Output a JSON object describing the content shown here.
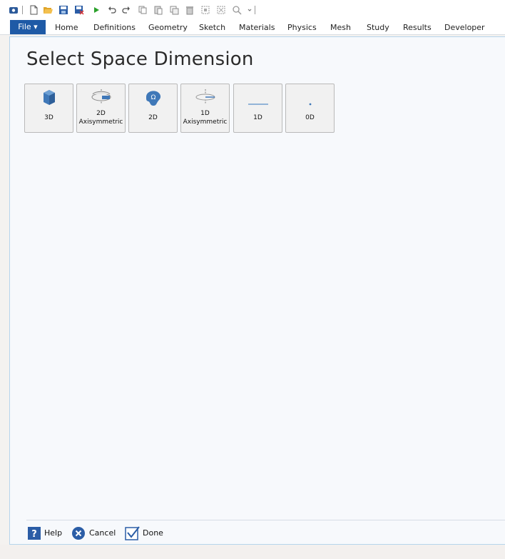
{
  "ribbon": {
    "file_label": "File ▾",
    "tabs": [
      "Home",
      "Definitions",
      "Geometry",
      "Sketch",
      "Materials",
      "Physics",
      "Mesh",
      "Study",
      "Results",
      "Developer"
    ]
  },
  "main": {
    "title": "Select Space Dimension",
    "dimensions": [
      {
        "line1": "",
        "line2": "3D"
      },
      {
        "line1": "2D",
        "line2": "Axisymmetric"
      },
      {
        "line1": "",
        "line2": "2D"
      },
      {
        "line1": "1D",
        "line2": "Axisymmetric"
      },
      {
        "line1": "",
        "line2": "1D"
      },
      {
        "line1": "",
        "line2": "0D"
      }
    ]
  },
  "footer": {
    "help_label": "Help",
    "cancel_label": "Cancel",
    "done_label": "Done"
  },
  "colors": {
    "accent": "#1e5aa6",
    "icon_blue": "#3a74b5"
  }
}
